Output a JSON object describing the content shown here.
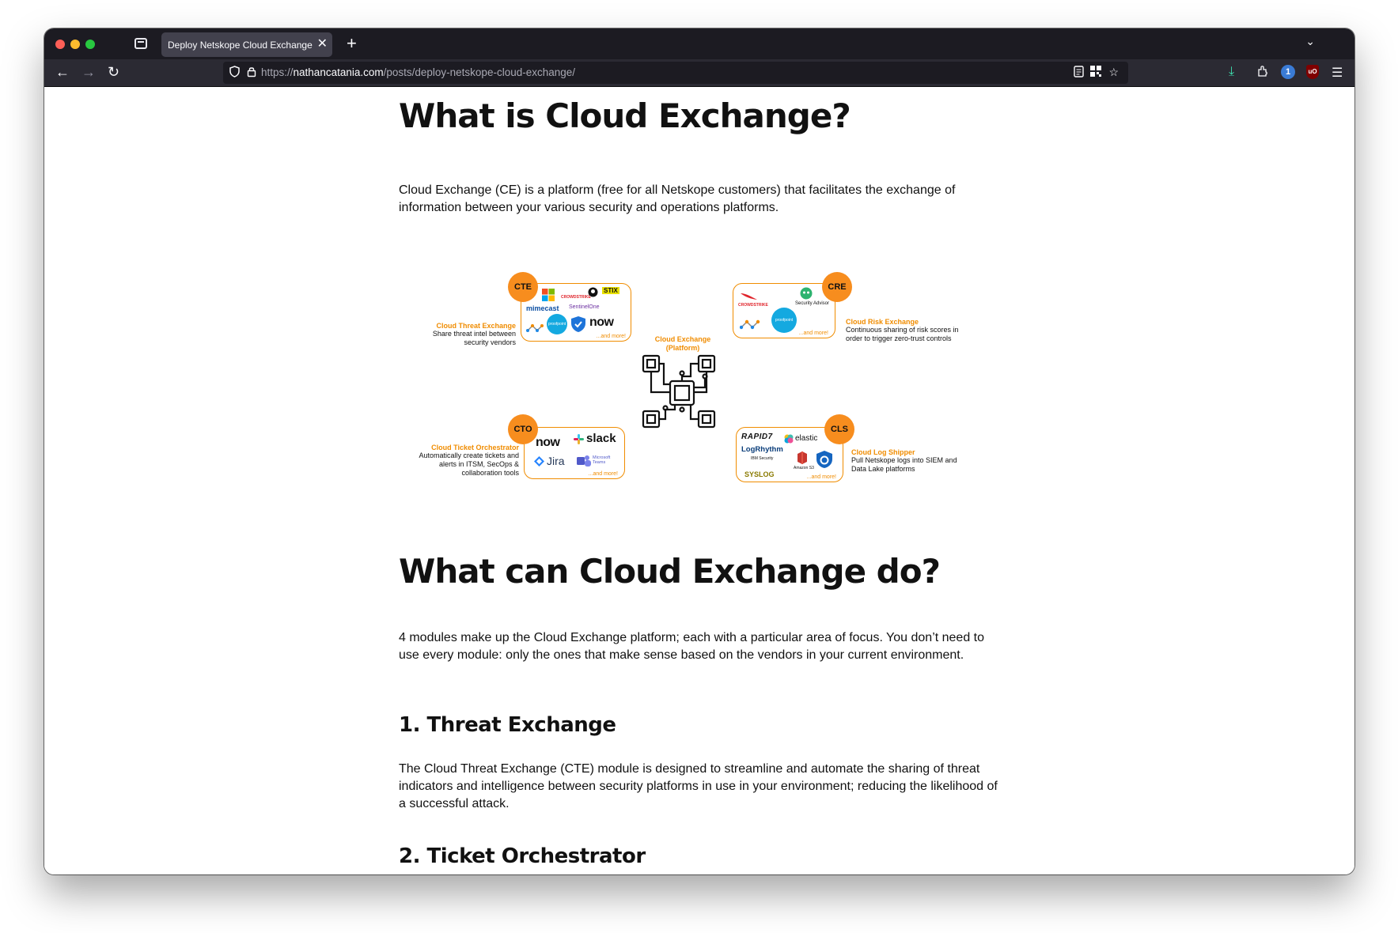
{
  "browser": {
    "tab_title": "Deploy Netskope Cloud Exchange :: Nathan Catania",
    "url_scheme": "https://",
    "url_host": "nathancatania.com",
    "url_path": "/posts/deploy-netskope-cloud-exchange/"
  },
  "article": {
    "h1_what": "What is Cloud Exchange?",
    "p_what": "Cloud Exchange (CE) is a platform (free for all Netskope customers) that facilitates the exchange of information between your various security and operations platforms.",
    "h1_can": "What can Cloud Exchange do?",
    "p_can": "4 modules make up the Cloud Exchange platform; each with a particular area of focus. You don’t need to use every module: only the ones that make sense based on the vendors in your current environment.",
    "h2_threat": "1. Threat Exchange",
    "p_threat": "The Cloud Threat Exchange (CTE) module is designed to streamline and automate the sharing of threat indicators and intelligence between security platforms in use in your environment; reducing the likelihood of a successful attack.",
    "h2_ticket": "2. Ticket Orchestrator"
  },
  "diagram": {
    "platform_label": "Cloud Exchange (Platform)",
    "more": "...and more!",
    "cte": {
      "badge": "CTE",
      "title": "Cloud Threat Exchange",
      "desc": "Share threat intel between security vendors",
      "logos": [
        "mimecast",
        "SentinelOne",
        "STIX",
        "CROWDSTRIKE",
        "proofpoint",
        "now"
      ]
    },
    "cre": {
      "badge": "CRE",
      "title": "Cloud Risk Exchange",
      "desc": "Continuous sharing of risk scores in order to trigger zero-trust controls",
      "logos": [
        "CROWDSTRIKE",
        "Security Advisor",
        "proofpoint"
      ]
    },
    "cto": {
      "badge": "CTO",
      "title": "Cloud Ticket Orchestrator",
      "desc": "Automatically create tickets and alerts in ITSM, SecOps & collaboration tools",
      "logos": [
        "now",
        "slack",
        "Jira",
        "Microsoft Teams"
      ]
    },
    "cls": {
      "badge": "CLS",
      "title": "Cloud Log Shipper",
      "desc": "Pull Netskope logs into SIEM and Data Lake platforms",
      "logos": [
        "RAPID7",
        "elastic",
        "LogRhythm",
        "IBM Security",
        "Amazon S3",
        "SYSLOG"
      ]
    }
  }
}
